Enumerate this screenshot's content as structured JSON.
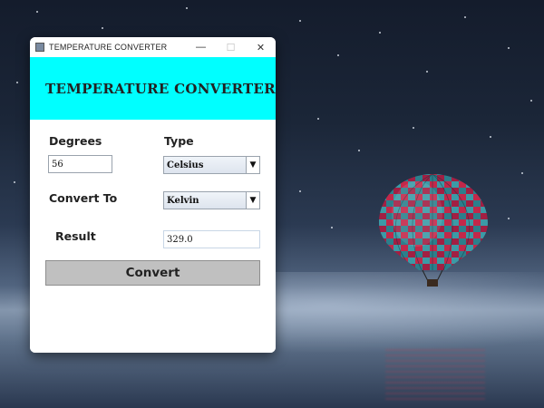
{
  "window": {
    "title": "TEMPERATURE  CONVERTER",
    "controls": {
      "minimize": "—",
      "maximize": "☐",
      "close": "✕"
    }
  },
  "header": {
    "title": "TEMPERATURE CONVERTER",
    "background": "#00ffff"
  },
  "form": {
    "degrees_label": "Degrees",
    "degrees_value": "56",
    "type_label": "Type",
    "type_selected": "Celsius",
    "convert_to_label": "Convert To",
    "convert_to_selected": "Kelvin",
    "result_label": "Result",
    "result_value": "329.0",
    "convert_button": "Convert"
  },
  "icons": {
    "app_icon": "java-app-icon",
    "dropdown_arrow": "chevron-down-icon",
    "arrow_glyph": "▼"
  }
}
